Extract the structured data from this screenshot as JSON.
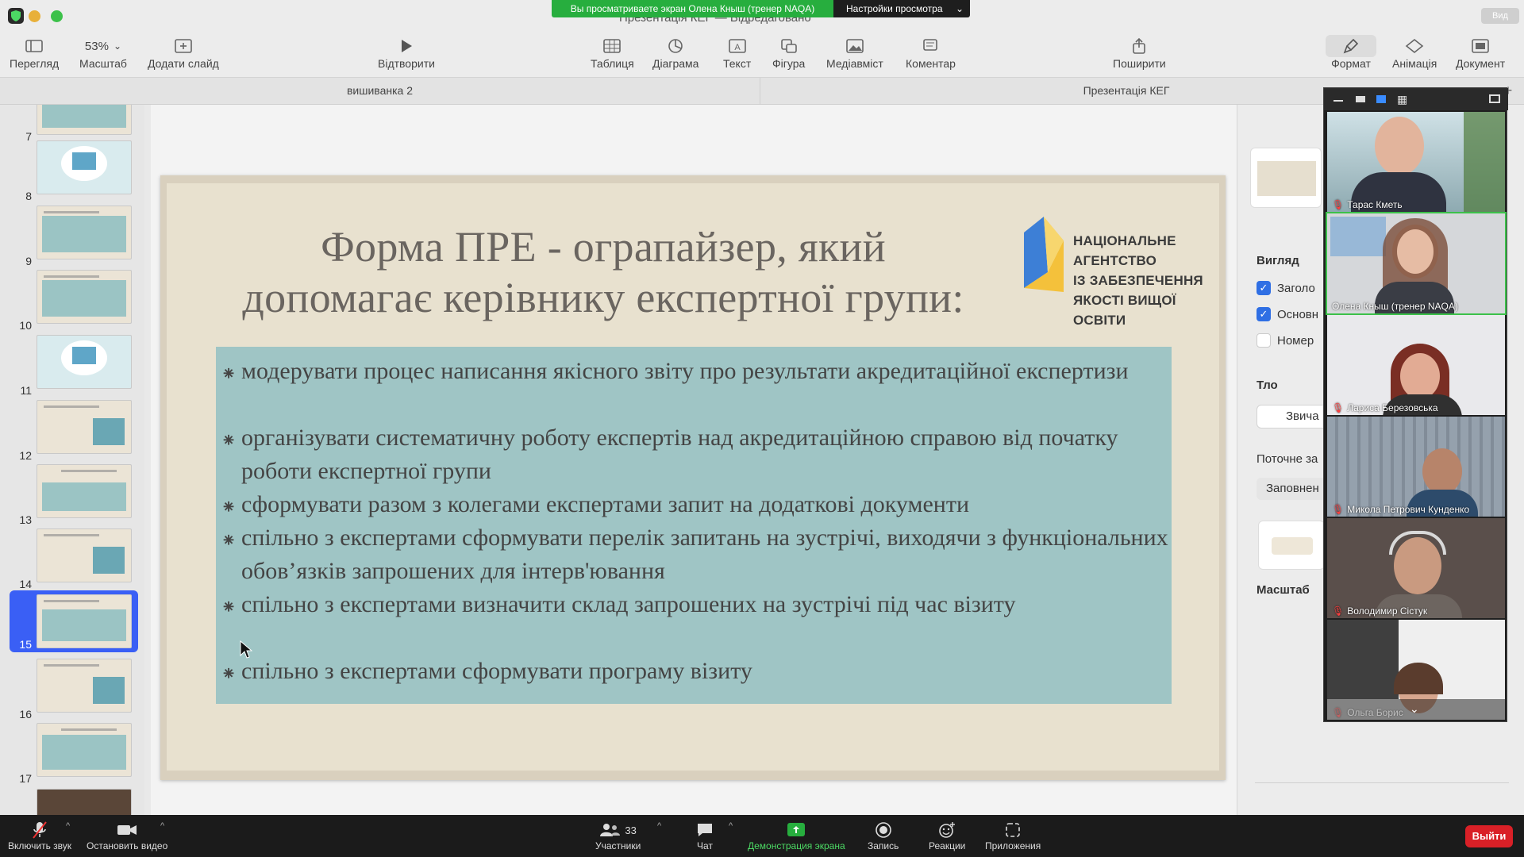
{
  "window": {
    "doc_title": "Презентація КЕГ — Відредаговано",
    "view_button": "Вид"
  },
  "share_banner": {
    "message": "Вы просматриваете экран Олена Кныш (тренер NAQA)",
    "settings": "Настройки просмотра"
  },
  "toolbar": {
    "view": "Перегляд",
    "zoom_value": "53%",
    "zoom": "Масштаб",
    "add_slide": "Додати слайд",
    "play": "Відтворити",
    "table": "Таблиця",
    "chart": "Діаграма",
    "text": "Текст",
    "shape": "Фігура",
    "media": "Медіавміст",
    "comment": "Коментар",
    "share": "Поширити",
    "format": "Формат",
    "animate": "Анімація",
    "document": "Документ"
  },
  "tabs": [
    "вишиванка 2",
    "Презентація КЕГ"
  ],
  "navigator": {
    "slides": [
      "7",
      "8",
      "9",
      "10",
      "11",
      "12",
      "13",
      "14",
      "15",
      "16",
      "17"
    ],
    "selected": "15"
  },
  "slide": {
    "title_line1": "Форма ПРЕ - ограпайзер, який",
    "title_line2": "допомагає керівнику експертної групи:",
    "logo_lines": [
      "НАЦІОНАЛЬНЕ",
      "АГЕНТСТВО",
      "ІЗ ЗАБЕЗПЕЧЕННЯ",
      "ЯКОСТІ ВИЩОЇ ОСВІТИ"
    ],
    "bullet_marker": "⁕",
    "bullets": [
      "модерувати процес написання якісного звіту про результати акредитаційної   експертизи",
      "організувати систематичну роботу експертів над акредитаційною справою від початку роботи експертної групи",
      "сформувати разом з колегами експертами запит на додаткові документи",
      "спільно з експертами сформувати перелік запитань на зустрічі, виходячи з функціональних обов’язків запрошених для інтерв'ювання",
      "спільно з експертами визначити склад запрошених на зустрічі під час візиту",
      "спільно з експертами сформувати програму візиту"
    ]
  },
  "inspector": {
    "view_label": "Вигляд",
    "check_title": "Заголо",
    "check_body": "Основн",
    "check_number": "Номер",
    "background_label": "Тло",
    "background_value": "Звича",
    "current_label": "Поточне за",
    "fill_value": "Заповнен",
    "scale_label": "Масштаб"
  },
  "participants": [
    {
      "name": "Тарас Кметь",
      "muted": true
    },
    {
      "name": "Олена Кныш (тренер NAQA)",
      "muted": false
    },
    {
      "name": "Лариса Березовська",
      "muted": true
    },
    {
      "name": "Микола  Петрович Кунденко",
      "muted": true
    },
    {
      "name": "Володимир  Сістук",
      "muted": true
    },
    {
      "name": "Ольга Борис",
      "muted": true
    }
  ],
  "bottombar": {
    "unmute": "Включить звук",
    "stop_video": "Остановить видео",
    "participants": "Участники",
    "participants_count": "33",
    "chat": "Чат",
    "share_screen": "Демонстрация экрана",
    "record": "Запись",
    "reactions": "Реакции",
    "apps": "Приложения",
    "leave": "Выйти"
  },
  "colors": {
    "share_green": "#27ae3e",
    "selected_blue": "#3a5ff5",
    "bullet_box": "#9fc5c5",
    "leave_red": "#d92027",
    "logo_blue": "#3d7fd6",
    "logo_yellow": "#f4c13b"
  }
}
